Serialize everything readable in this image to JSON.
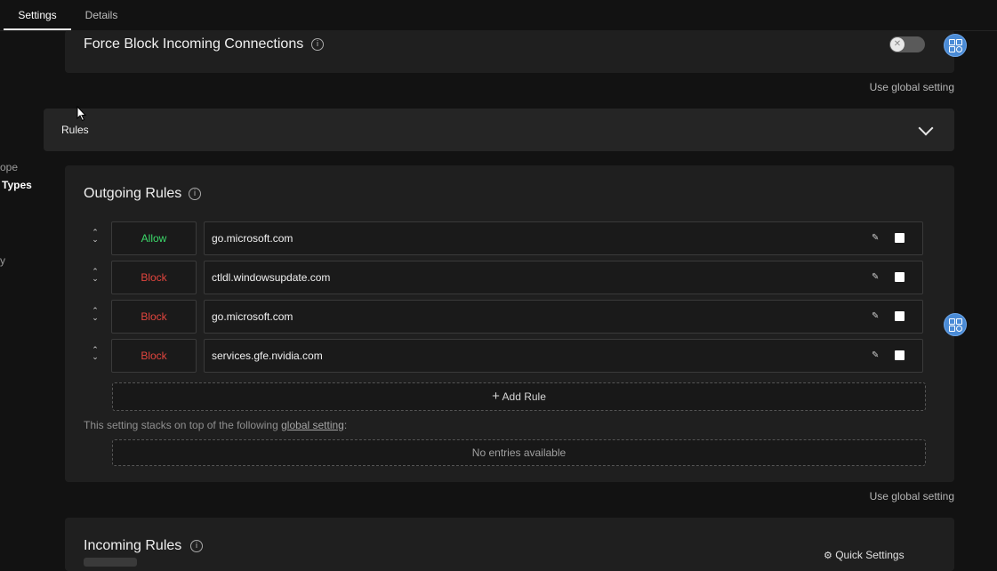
{
  "tabs": [
    {
      "label": "Settings",
      "active": true
    },
    {
      "label": "Details",
      "active": false
    }
  ],
  "sidebar": {
    "partial_items": [
      "ope",
      "Types",
      "y"
    ]
  },
  "force_block": {
    "title": "Force Block Incoming Connections",
    "enabled": false,
    "use_global": "Use global setting"
  },
  "rules_section": {
    "label": "Rules"
  },
  "outgoing": {
    "title": "Outgoing Rules",
    "rules": [
      {
        "action": "Allow",
        "value": "go.microsoft.com"
      },
      {
        "action": "Block",
        "value": "ctldl.windowsupdate.com"
      },
      {
        "action": "Block",
        "value": "go.microsoft.com"
      },
      {
        "action": "Block",
        "value": "services.gfe.nvidia.com"
      }
    ],
    "add_rule": "Add Rule",
    "stack_hint_prefix": "This setting stacks on top of the following ",
    "stack_hint_link": "global setting",
    "stack_hint_suffix": ":",
    "no_entries": "No entries available",
    "use_global": "Use global setting"
  },
  "incoming": {
    "title": "Incoming Rules",
    "quick_settings": "Quick Settings"
  },
  "colors": {
    "allow": "#3cd96a",
    "block": "#e2453e",
    "accent": "#4a8bd6"
  },
  "icons": [
    "info-icon",
    "toggle-off-icon",
    "chevron-down-icon",
    "drag-handle-icon",
    "edit-icon",
    "plus-icon",
    "sliders-icon",
    "settings-fab-icon",
    "mouse-cursor-icon"
  ]
}
